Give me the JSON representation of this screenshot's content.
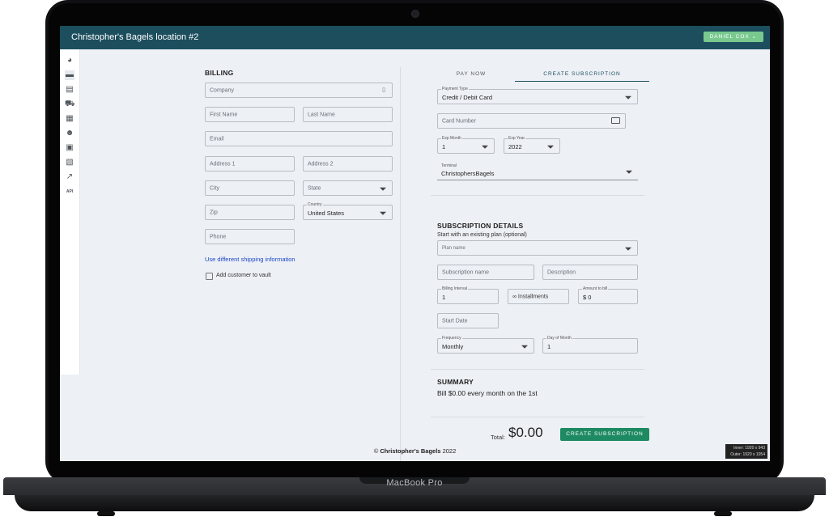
{
  "app": {
    "title": "Christopher's Bagels location #2",
    "user_button": "DANIEL COX"
  },
  "sidebar_icons": [
    "dashboard-icon",
    "card-icon",
    "receipt-icon",
    "cart-icon",
    "calendar-icon",
    "users-icon",
    "box-icon",
    "invoice-icon",
    "chart-icon",
    "api-icon"
  ],
  "sidebar_api_label": "API",
  "billing": {
    "title": "BILLING",
    "company_placeholder": "Company",
    "first_name_placeholder": "First Name",
    "last_name_placeholder": "Last Name",
    "email_placeholder": "Email",
    "address1_placeholder": "Address 1",
    "address2_placeholder": "Address 2",
    "city_placeholder": "City",
    "state_placeholder": "State",
    "zip_placeholder": "Zip",
    "country_label": "Country",
    "country_value": "United States",
    "phone_placeholder": "Phone",
    "shipping_link": "Use different shipping information",
    "vault_label": "Add customer to vault"
  },
  "tabs": {
    "pay_now": "PAY NOW",
    "create_subscription": "CREATE SUBSCRIPTION"
  },
  "payment": {
    "type_label": "Payment Type",
    "type_value": "Credit / Debit Card",
    "card_number_placeholder": "Card Number",
    "exp_month_label": "Exp Month",
    "exp_month_value": "1",
    "exp_year_label": "Exp Year",
    "exp_year_value": "2022",
    "terminal_label": "Terminal",
    "terminal_value": "ChristophersBagels"
  },
  "subscription": {
    "title": "SUBSCRIPTION DETAILS",
    "existing_plan_text": "Start with an existing plan (optional)",
    "plan_name_placeholder": "Plan name",
    "name_placeholder": "Subscription name",
    "description_placeholder": "Description",
    "billing_interval_label": "Billing Interval",
    "billing_interval_value": "1",
    "installments_value": "∞ Installments",
    "amount_label": "Amount to bill",
    "amount_value": "$ 0",
    "start_date_placeholder": "Start Date",
    "frequency_label": "Frequency",
    "frequency_value": "Monthly",
    "day_of_month_label": "Day of Month",
    "day_of_month_value": "1"
  },
  "summary": {
    "title": "SUMMARY",
    "text": "Bill $0.00 every month on the 1st"
  },
  "footer": {
    "total_label": "Total:",
    "total_value": "$0.00",
    "create_button": "CREATE SUBSCRIPTION",
    "copyright_symbol": "©",
    "copyright_name": "Christopher's Bagels",
    "copyright_year": "2022"
  },
  "viewport_badge": {
    "inner": "Inner: 1920 x 943",
    "outer": "Outer: 1920 x 1054"
  },
  "device_label": "MacBook Pro"
}
